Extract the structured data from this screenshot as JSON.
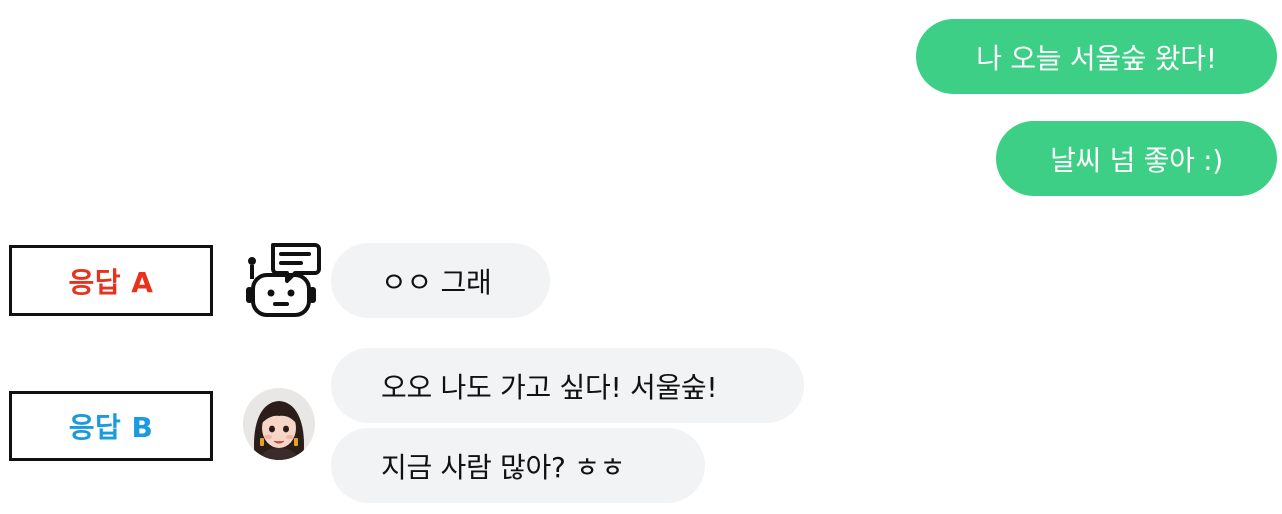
{
  "user_messages": [
    "나 오늘 서울숲 왔다!",
    "날씨 넘 좋아 :)"
  ],
  "response_a": {
    "label": "응답 A",
    "label_color": "#e8321e",
    "avatar_icon": "robot-chat-icon",
    "messages": [
      "ㅇㅇ 그래"
    ]
  },
  "response_b": {
    "label": "응답 B",
    "label_color": "#1a9be0",
    "avatar": "person-avatar",
    "messages": [
      "오오 나도 가고 싶다! 서울숲!",
      "지금 사람 많아? ㅎㅎ"
    ]
  },
  "colors": {
    "user_bubble": "#3ecf87",
    "reply_bubble": "#f2f3f5"
  }
}
